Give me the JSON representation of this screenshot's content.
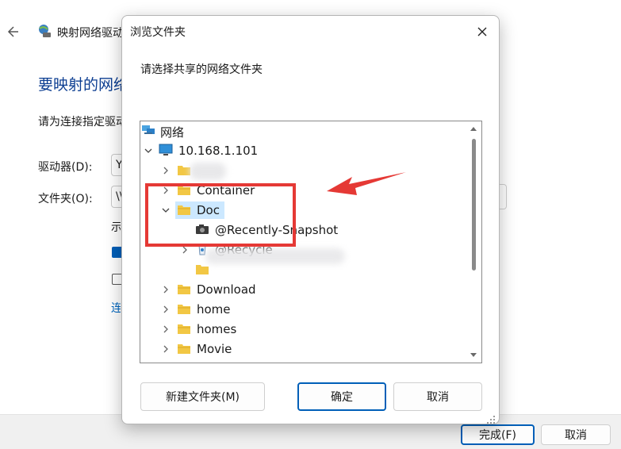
{
  "wizard": {
    "title": "映射网络驱动器",
    "heading": "要映射的网络文件夹",
    "description": "请为连接指定驱动器号，以及要连接的文件夹：",
    "drive_label": "驱动器(D):",
    "drive_value": "Y:",
    "folder_label": "文件夹(O):",
    "folder_value": "\\\\",
    "option_text": "示例: \\\\server\\share",
    "link_text": "连接到可用于存储文档和图片的网站。",
    "finish_label": "完成(F)",
    "cancel_label": "取消"
  },
  "dialog": {
    "title": "浏览文件夹",
    "prompt": "请选择共享的网络文件夹",
    "new_folder_label": "新建文件夹(M)",
    "ok_label": "确定",
    "cancel_label": "取消"
  },
  "tree": {
    "root_label": "网络",
    "host_label": "10.168.1.101",
    "items": [
      {
        "label": "Container",
        "icon": "folder-icon"
      },
      {
        "label": "Doc",
        "icon": "folder-icon",
        "selected": true
      },
      {
        "label": "@Recently-Snapshot",
        "icon": "camera-icon"
      },
      {
        "label": "@Recycle",
        "icon": "recycle-bin-icon"
      },
      {
        "label": "Download",
        "icon": "folder-icon"
      },
      {
        "label": "home",
        "icon": "folder-icon"
      },
      {
        "label": "homes",
        "icon": "folder-icon"
      },
      {
        "label": "Movie",
        "icon": "folder-icon"
      }
    ]
  },
  "colors": {
    "accent": "#005fb8",
    "selection": "#cce8ff",
    "annotation": "#e53935",
    "folder": "#f2c744"
  }
}
